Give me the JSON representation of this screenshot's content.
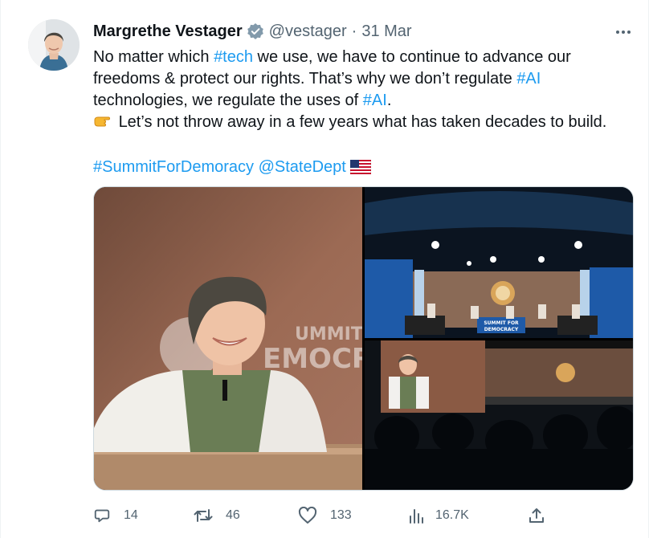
{
  "tweet": {
    "author_name": "Margrethe Vestager",
    "handle": "@vestager",
    "separator": "·",
    "date": "31 Mar",
    "lines": [
      [
        "No matter which ",
        "#tech",
        " we use, we have to continue to advance our"
      ],
      [
        "freedoms & protect our rights. That’s why we don’t regulate ",
        "#AI"
      ],
      [
        "technologies, we regulate the uses of ",
        "#AI",
        "."
      ],
      [
        "Let’s not throw away in a few years what has taken decades to build."
      ]
    ],
    "hashtag_summit": "#SummitForDemoracy",
    "mention_state": "@StateDept",
    "banner_text": [
      "UMMIT FOR",
      "EMOCRA"
    ],
    "stage_text": [
      "SUMMIT FOR",
      "DEMOCRACY"
    ]
  },
  "actions": {
    "replies": "14",
    "retweets": "46",
    "likes": "133",
    "views": "16.7K"
  },
  "icons": {
    "verified": "verified-badge-icon",
    "more": "more-options-icon",
    "reply": "reply-icon",
    "retweet": "retweet-icon",
    "like": "heart-icon",
    "views": "analytics-icon",
    "share": "share-icon",
    "pointing": "pointing-hand-icon",
    "flag": "us-flag-icon"
  },
  "colors": {
    "link": "#1d9bf0",
    "muted": "#536471",
    "badge": "#829aab"
  }
}
